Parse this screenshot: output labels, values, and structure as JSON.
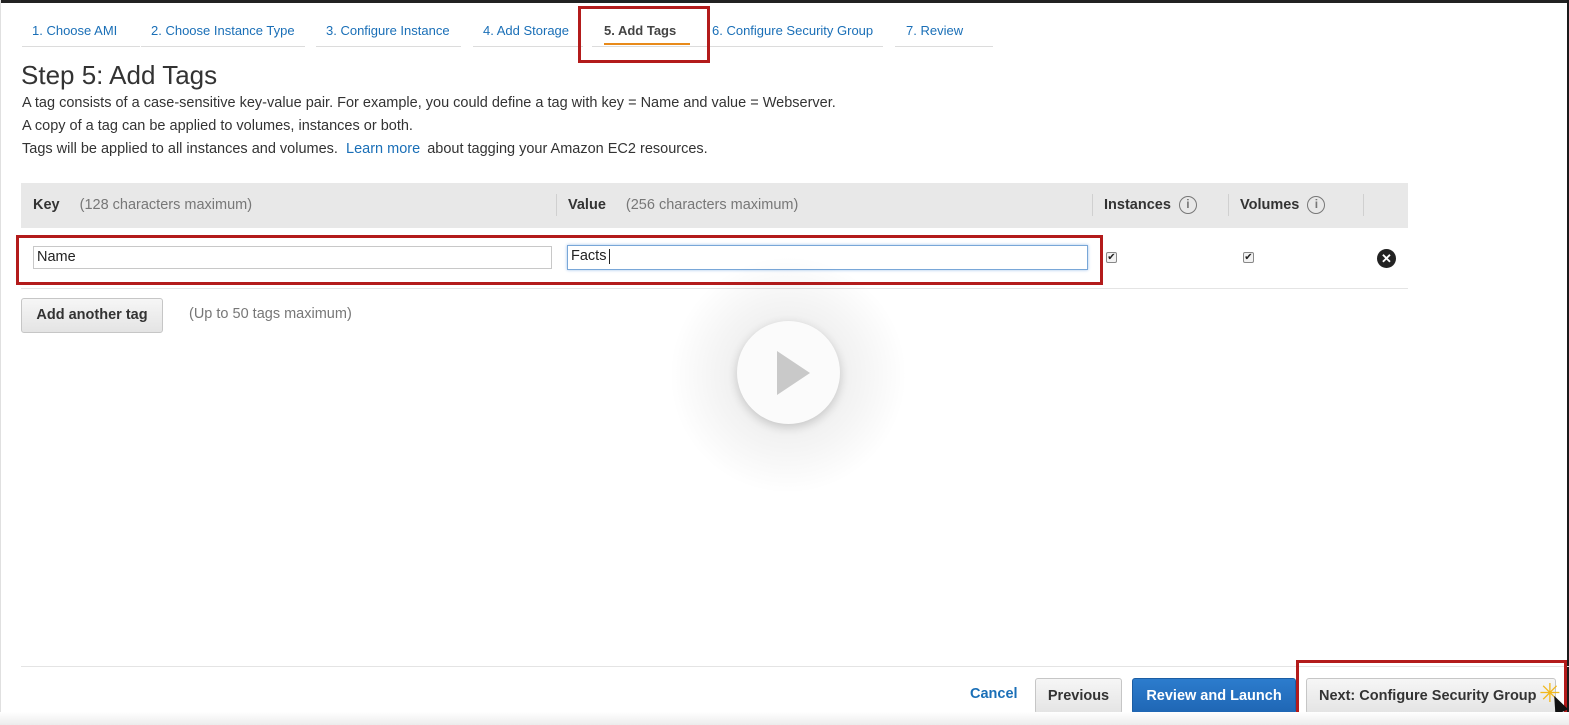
{
  "wizard": {
    "tabs": [
      {
        "label": "1. Choose AMI"
      },
      {
        "label": "2. Choose Instance Type"
      },
      {
        "label": "3. Configure Instance"
      },
      {
        "label": "4. Add Storage"
      },
      {
        "label": "5. Add Tags",
        "active": true
      },
      {
        "label": "6. Configure Security Group"
      },
      {
        "label": "7. Review"
      }
    ]
  },
  "page": {
    "title": "Step 5: Add Tags",
    "description_1": "A tag consists of a case-sensitive key-value pair. For example, you could define a tag with key = Name and value = Webserver.",
    "description_2": "A copy of a tag can be applied to volumes, instances or both.",
    "description_3_pre": "Tags will be applied to all instances and volumes.",
    "learn_more": "Learn more",
    "description_3_post": "about tagging your Amazon EC2 resources."
  },
  "tag_table": {
    "headers": {
      "key": "Key",
      "key_hint": "(128 characters maximum)",
      "value": "Value",
      "value_hint": "(256 characters maximum)",
      "instances": "Instances",
      "volumes": "Volumes"
    },
    "rows": [
      {
        "key": "Name",
        "value": "Facts",
        "instances": true,
        "volumes": true
      }
    ]
  },
  "add_tag": {
    "button_label": "Add another tag",
    "limit_note": "(Up to 50 tags maximum)"
  },
  "footer": {
    "cancel": "Cancel",
    "previous": "Previous",
    "review_launch": "Review and Launch",
    "next": "Next: Configure Security Group"
  },
  "icons": {
    "info": "i",
    "remove": "✕",
    "check": "✔"
  },
  "colors": {
    "link": "#1a6fb7",
    "highlight": "#b31b1b",
    "active_tab_underline": "#e88a1a",
    "primary_button": "#1f66b4"
  }
}
